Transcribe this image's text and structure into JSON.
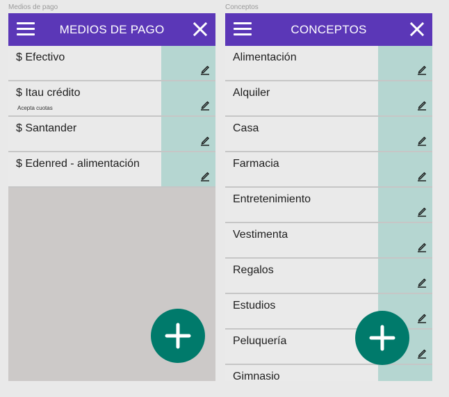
{
  "pagos": {
    "frame_label": "Medios de pago",
    "title": "MEDIOS DE PAGO",
    "items": [
      {
        "label": "$ Efectivo",
        "sub": ""
      },
      {
        "label": "$ Itau crédito",
        "sub": "Acepta cuotas"
      },
      {
        "label": "$ Santander",
        "sub": ""
      },
      {
        "label": "$ Edenred - alimentación",
        "sub": ""
      }
    ]
  },
  "conceptos": {
    "frame_label": "Conceptos",
    "title": "CONCEPTOS",
    "items": [
      {
        "label": "Alimentación"
      },
      {
        "label": "Alquiler"
      },
      {
        "label": "Casa"
      },
      {
        "label": "Farmacia"
      },
      {
        "label": "Entretenimiento"
      },
      {
        "label": "Vestimenta"
      },
      {
        "label": "Regalos"
      },
      {
        "label": "Estudios"
      },
      {
        "label": "Peluquería"
      },
      {
        "label": "Gimnasio"
      }
    ]
  },
  "icons": {
    "menu": "menu-icon",
    "close": "close-icon",
    "edit": "edit-icon",
    "add": "plus-icon"
  },
  "colors": {
    "appbar": "#5b37b7",
    "edit_cell": "#b5d6d1",
    "fab": "#007a6b",
    "row_bg": "#eaeaea",
    "empty_bg": "#ccc9c8"
  }
}
